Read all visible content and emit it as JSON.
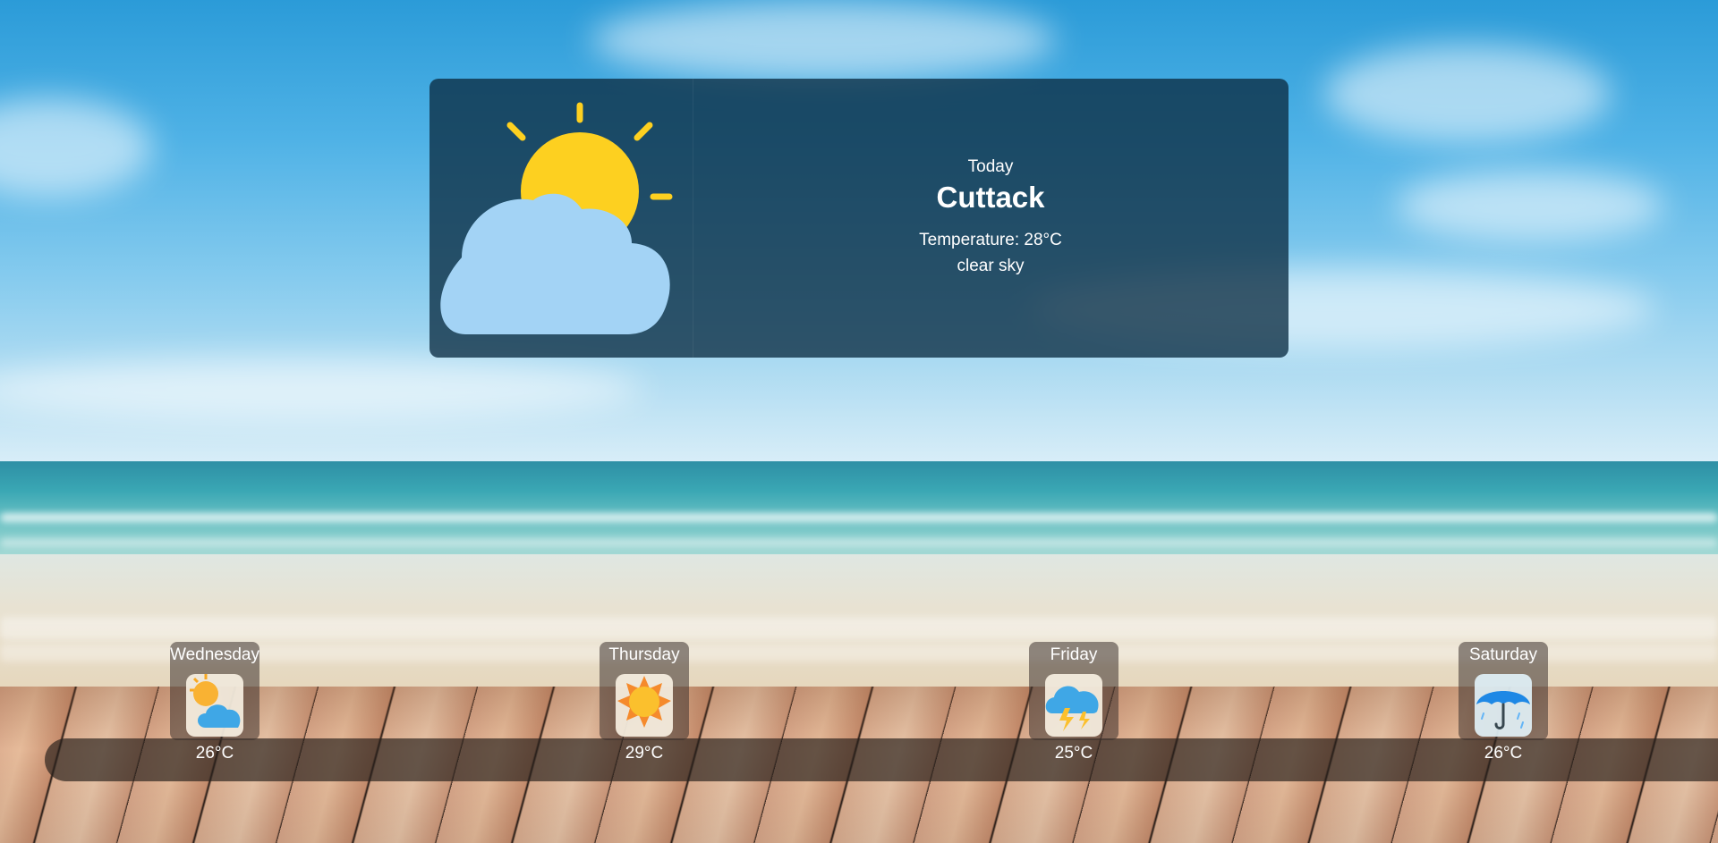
{
  "today": {
    "label": "Today",
    "city": "Cuttack",
    "temperature": "Temperature: 28°C",
    "description": "clear sky",
    "icon": "partly-cloudy-sun-icon"
  },
  "forecast": [
    {
      "day": "Wednesday",
      "temp": "26°C",
      "icon": "sun-behind-cloud-icon"
    },
    {
      "day": "Thursday",
      "temp": "29°C",
      "icon": "sun-icon"
    },
    {
      "day": "Friday",
      "temp": "25°C",
      "icon": "thunder-cloud-icon"
    },
    {
      "day": "Saturday",
      "temp": "26°C",
      "icon": "umbrella-rain-icon"
    }
  ],
  "colors": {
    "card_background": "#0c2d42",
    "sun": "#fdd020",
    "cloud": "#a3d3f5",
    "text": "#ffffff"
  }
}
